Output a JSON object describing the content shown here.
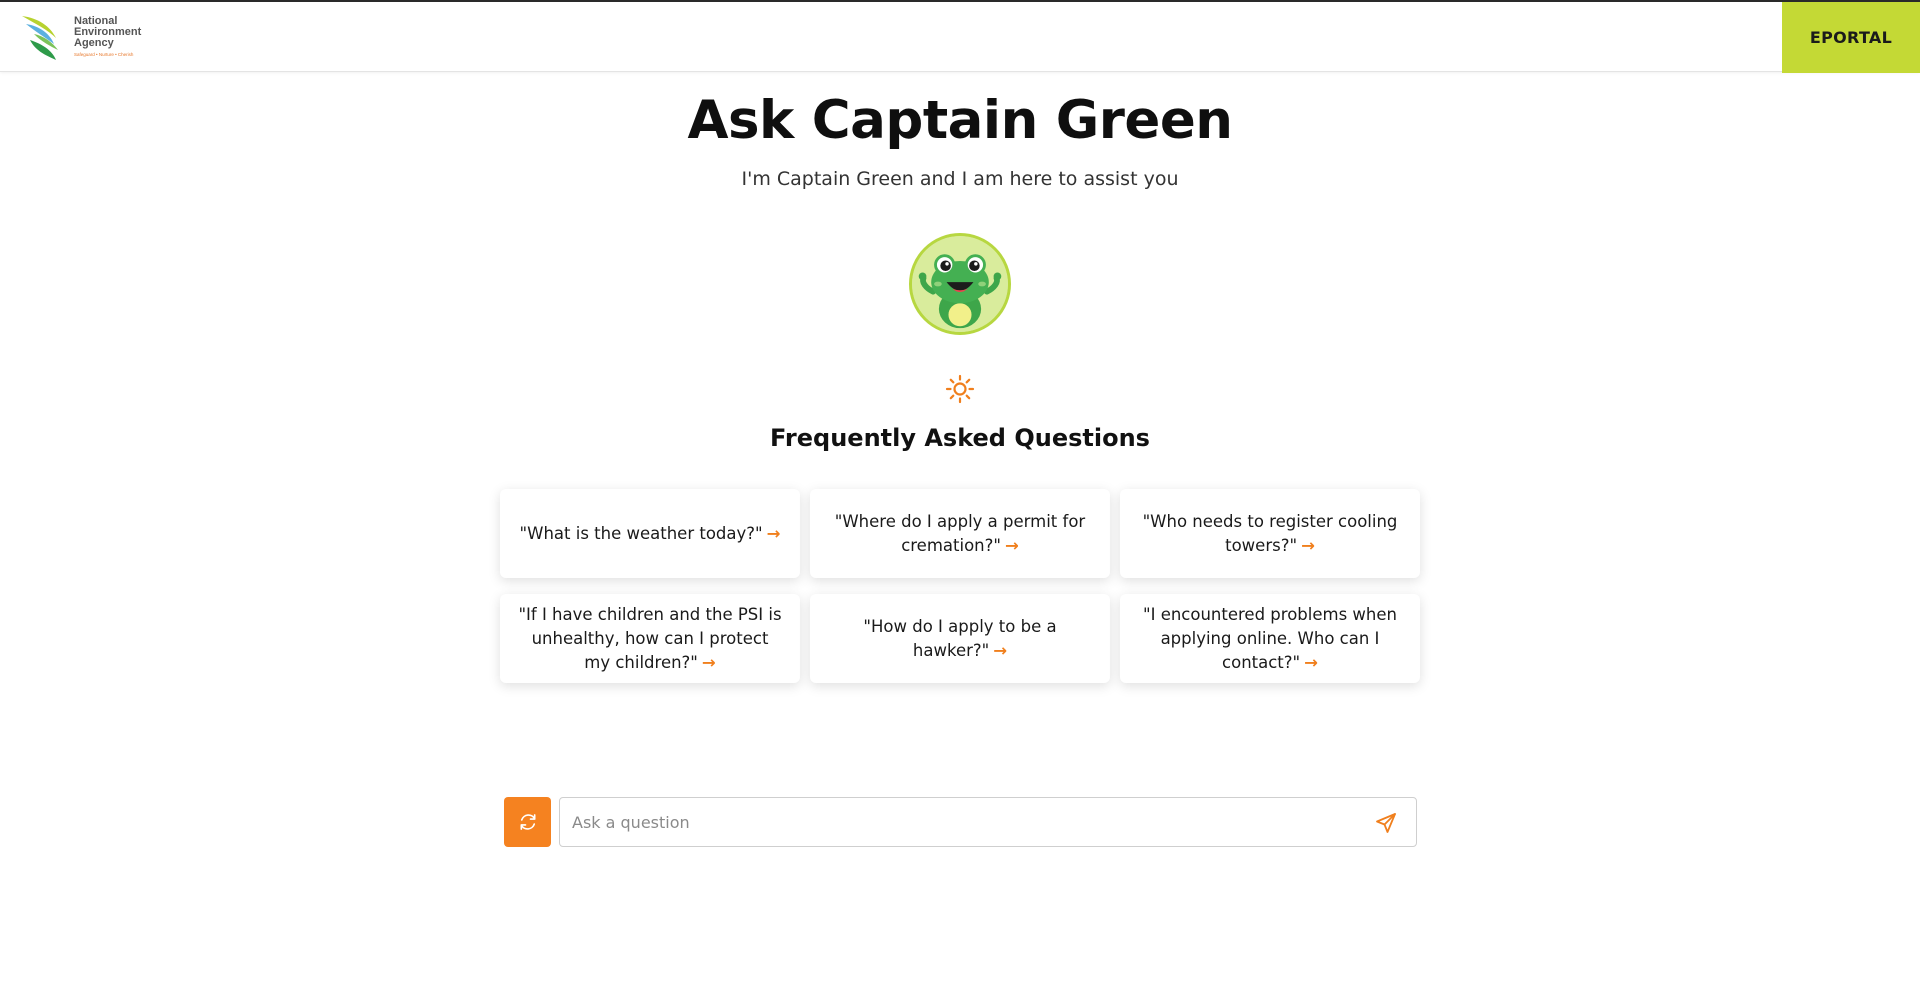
{
  "header": {
    "logo": {
      "line1": "National",
      "line2": "Environment",
      "line3": "Agency",
      "tagline": "Safeguard • Nurture • Cherish"
    },
    "eportal_label": "EPORTAL"
  },
  "hero": {
    "title": "Ask Captain Green",
    "subtitle": "I'm Captain Green and I am here to assist you",
    "avatar_icon": "frog-mascot-icon"
  },
  "faq": {
    "icon": "sun-icon",
    "title": "Frequently Asked Questions",
    "items": [
      {
        "text": "\"What is the weather today?\""
      },
      {
        "text": "\"Where do I apply a permit for cremation?\""
      },
      {
        "text": "\"Who needs to register cooling towers?\""
      },
      {
        "text": "\"If I have children and the PSI is unhealthy, how can I protect my children?\""
      },
      {
        "text": "\"How do I apply to be a hawker?\""
      },
      {
        "text": "\"I encountered problems when applying online. Who can I contact?\""
      }
    ]
  },
  "chat": {
    "refresh_icon": "refresh-icon",
    "placeholder": "Ask a question",
    "send_icon": "send-icon"
  },
  "colors": {
    "accent_orange": "#f58220",
    "eportal_green": "#c4d935"
  }
}
